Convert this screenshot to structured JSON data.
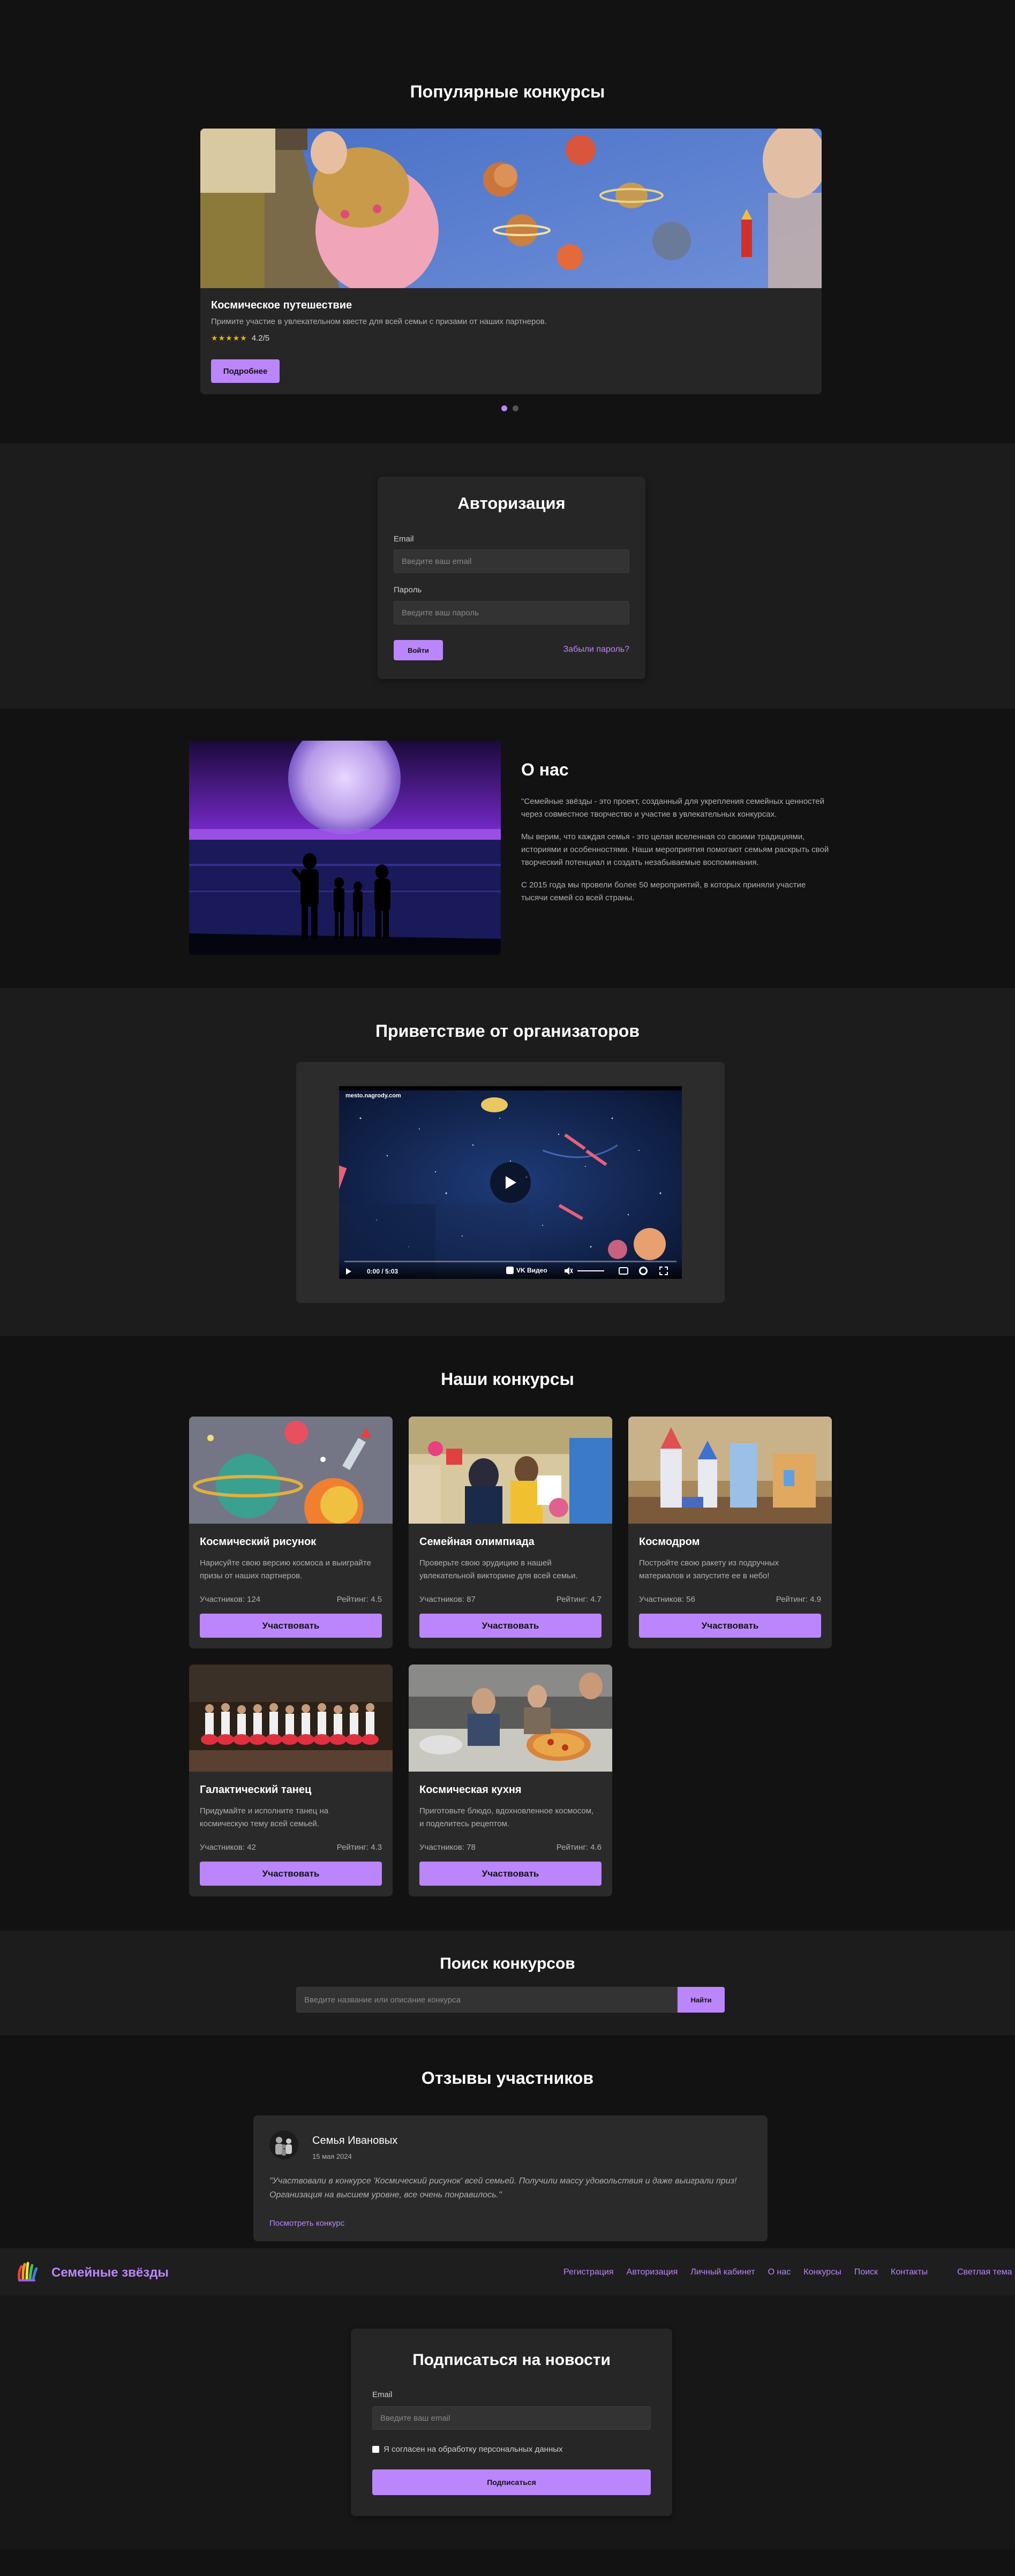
{
  "popular": {
    "title": "Популярные конкурсы",
    "slide": {
      "title": "Космическое путешествие",
      "desc": "Примите участие в увлекательном квесте для всей семьи с призами от наших партнеров.",
      "stars": "★★★★★",
      "rating": "4.2/5",
      "button": "Подробнее"
    },
    "dots": 2,
    "active_dot": 1
  },
  "auth": {
    "title": "Авторизация",
    "email_label": "Email",
    "email_placeholder": "Введите ваш email",
    "password_label": "Пароль",
    "password_placeholder": "Введите ваш пароль",
    "login_button": "Войти",
    "forgot": "Забыли пароль?"
  },
  "about": {
    "title": "О нас",
    "p1": "\"Семейные звёзды - это проект, созданный для укрепления семейных ценностей через совместное творчество и участие в увлекательных конкурсах.",
    "p2": "Мы верим, что каждая семья - это целая вселенная со своими традициями, историями и особенностями. Наши мероприятия помогают семьям раскрыть свой творческий потенциал и создать незабываемые воспоминания.",
    "p3": "С 2015 года мы провели более 50 мероприятий, в которых приняли участие тысячи семей со всей страны."
  },
  "welcome": {
    "title": "Приветствие от организаторов",
    "video_watermark": "mesto.nagrody.com",
    "time": "0:00 / 5:03",
    "provider": "VK Видео"
  },
  "contests": {
    "title": "Наши конкурсы",
    "participants_label": "Участников:",
    "rating_label": "Рейтинг:",
    "items": [
      {
        "title": "Космический рисунок",
        "desc": "Нарисуйте свою версию космоса и выиграйте призы от наших партнеров.",
        "participants": "Участников: 124",
        "rating": "Рейтинг: 4.5",
        "button": "Участвовать"
      },
      {
        "title": "Семейная олимпиада",
        "desc": "Проверьте свою эрудицию в нашей увлекательной викторине для всей семьи.",
        "participants": "Участников: 87",
        "rating": "Рейтинг: 4.7",
        "button": "Участвовать"
      },
      {
        "title": "Космодром",
        "desc": "Постройте свою ракету из подручных материалов и запустите ее в небо!",
        "participants": "Участников: 56",
        "rating": "Рейтинг: 4.9",
        "button": "Участвовать"
      },
      {
        "title": "Галактический танец",
        "desc": "Придумайте и исполните танец на космическую тему всей семьей.",
        "participants": "Участников: 42",
        "rating": "Рейтинг: 4.3",
        "button": "Участвовать"
      },
      {
        "title": "Космическая кухня",
        "desc": "Приготовьте блюдо, вдохновленное космосом, и поделитесь рецептом.",
        "participants": "Участников: 78",
        "rating": "Рейтинг: 4.6",
        "button": "Участвовать"
      }
    ]
  },
  "search": {
    "title": "Поиск конкурсов",
    "placeholder": "Введите название или описание конкурса",
    "button": "Найти"
  },
  "reviews": {
    "title": "Отзывы участников",
    "name": "Семья Ивановых",
    "date": "15 мая 2024",
    "text": "\"Участвовали в конкурсе 'Космический рисунок' всей семьей. Получили массу удовольствия и даже выиграли приз! Организация на высшем уровне, все очень понравилось.\"",
    "link": "Посмотреть конкурс"
  },
  "navbar": {
    "brand": "Семейные звёзды",
    "links": [
      "Регистрация",
      "Авторизация",
      "Личный кабинет",
      "О нас",
      "Конкурсы",
      "Поиск",
      "Контакты"
    ],
    "theme": "Светлая тема"
  },
  "subscribe": {
    "title": "Подписаться на новости",
    "email_label": "Email",
    "email_placeholder": "Введите ваш email",
    "consent": "Я согласен на обработку персональных данных",
    "button": "Подписаться"
  },
  "colors": {
    "accent": "#bb86fc",
    "background": "#121212",
    "surface": "#2a2a2a",
    "star": "#f5b301"
  }
}
